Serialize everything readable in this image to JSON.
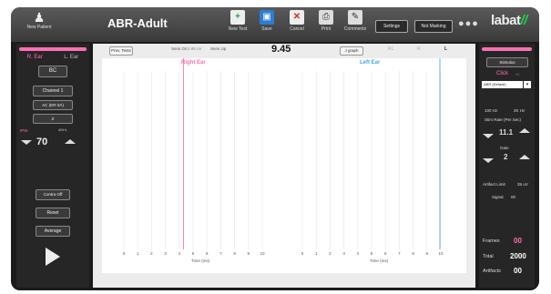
{
  "header": {
    "new_patient_label": "New Patient",
    "app_title": "ABR-Adult",
    "toolbar": [
      {
        "label": "New Test",
        "icon": "new-test-icon"
      },
      {
        "label": "Save",
        "icon": "save-icon"
      },
      {
        "label": "Cancel",
        "icon": "cancel-icon"
      },
      {
        "label": "Print",
        "icon": "print-icon"
      },
      {
        "label": "Comments",
        "icon": "comments-icon"
      }
    ],
    "settings_label": "Settings",
    "not_marking_label": "Not Marking",
    "logo_text": "labat",
    "logo_mark": "//",
    "colors": {
      "accent_pink": "#ff6fb3",
      "accent_green": "#19d64a",
      "accent_blue": "#4aa8e8"
    }
  },
  "left_panel": {
    "ear_right": "R. Ear",
    "ear_left": "L. Ear",
    "bc_label": "BC",
    "channel_label": "Channel 1",
    "transducer_label": "AC (ER-3A)",
    "z_label": "Z",
    "ipsi_label": "IPSI",
    "unit_label": "dBHL",
    "level_value": "70",
    "contra_label": "Contra Off",
    "reset_label": "Reset",
    "average_label": "Average"
  },
  "main": {
    "prev_tests_label": "Prev. Tests",
    "sens_on_label": "Sens On",
    "sens_value": "2.88 uV",
    "sens_up_label": "Sens Up",
    "time_value": "9.45",
    "graph_button_label": "J graph",
    "rl_label": "RL",
    "r_label": "R",
    "l_label": "L",
    "right_ear_title": "Right Ear",
    "left_ear_title": "Left Ear"
  },
  "chart_data": [
    {
      "type": "line",
      "title": "Right Ear",
      "xlabel": "Time (ms)",
      "x_ticks": [
        "0",
        "1",
        "2",
        "3",
        "4",
        "5",
        "6",
        "7",
        "8",
        "9",
        "10"
      ],
      "xlim": [
        0,
        10
      ],
      "grid": true,
      "series": []
    },
    {
      "type": "line",
      "title": "Left Ear",
      "xlabel": "Time (ms)",
      "x_ticks": [
        "0",
        "1",
        "2",
        "3",
        "4",
        "5",
        "6",
        "7",
        "8",
        "9",
        "10"
      ],
      "xlim": [
        0,
        10
      ],
      "grid": true,
      "series": []
    }
  ],
  "right_panel": {
    "stimulus_label": "Stimulus",
    "click_label": "Click",
    "polarity_symbol": "+/-",
    "abr_default_value": "ABR (Default)",
    "filter_low": "100 Hz",
    "filter_high": "2K Hz",
    "stim_rate_label": "Stim Rate (Per Sec)",
    "stim_rate_value": "11.1",
    "gain_label": "Gain",
    "gain_value": "2",
    "artifact_limit_label": "Artifact Limit",
    "artifact_limit_value": "35 uV",
    "signal_label": "Signal",
    "signal_value": "00",
    "frames_label": "Frames",
    "frames_value": "00",
    "total_label": "Total",
    "total_value": "2000",
    "artifacts_label": "Artifacts",
    "artifacts_value": "00"
  }
}
